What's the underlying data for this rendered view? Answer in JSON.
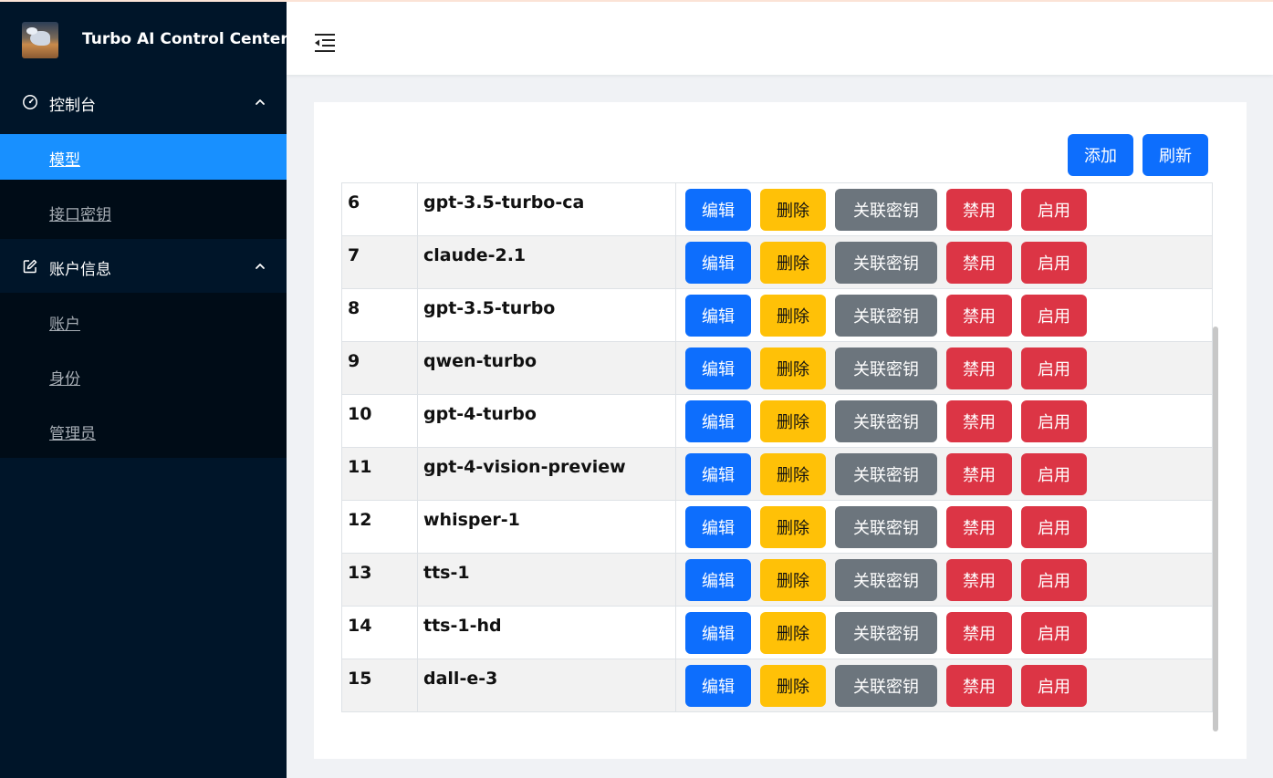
{
  "app": {
    "title": "Turbo AI Control Center",
    "logo": "turbo-horse-logo"
  },
  "sidebar": {
    "groups": [
      {
        "label": "控制台",
        "icon": "dashboard-icon",
        "expanded": true,
        "items": [
          {
            "label": "模型",
            "active": true
          },
          {
            "label": "接口密钥",
            "active": false
          }
        ]
      },
      {
        "label": "账户信息",
        "icon": "edit-icon",
        "expanded": true,
        "items": [
          {
            "label": "账户",
            "active": false
          },
          {
            "label": "身份",
            "active": false
          },
          {
            "label": "管理员",
            "active": false
          }
        ]
      }
    ]
  },
  "header": {
    "fold_icon": "menu-fold-icon"
  },
  "toolbar": {
    "add_label": "添加",
    "refresh_label": "刷新"
  },
  "actions": {
    "edit": "编辑",
    "delete": "删除",
    "bind_key": "关联密钥",
    "disable": "禁用",
    "enable": "启用"
  },
  "models": [
    {
      "id": "6",
      "name": "gpt-3.5-turbo-ca"
    },
    {
      "id": "7",
      "name": "claude-2.1"
    },
    {
      "id": "8",
      "name": "gpt-3.5-turbo"
    },
    {
      "id": "9",
      "name": "qwen-turbo"
    },
    {
      "id": "10",
      "name": "gpt-4-turbo"
    },
    {
      "id": "11",
      "name": "gpt-4-vision-preview"
    },
    {
      "id": "12",
      "name": "whisper-1"
    },
    {
      "id": "13",
      "name": "tts-1"
    },
    {
      "id": "14",
      "name": "tts-1-hd"
    },
    {
      "id": "15",
      "name": "dall-e-3"
    }
  ],
  "colors": {
    "sidebar_bg": "#001529",
    "active_item": "#1890ff",
    "primary": "#0d6efd",
    "warning": "#ffc107",
    "secondary": "#6c757d",
    "danger": "#dc3545"
  }
}
